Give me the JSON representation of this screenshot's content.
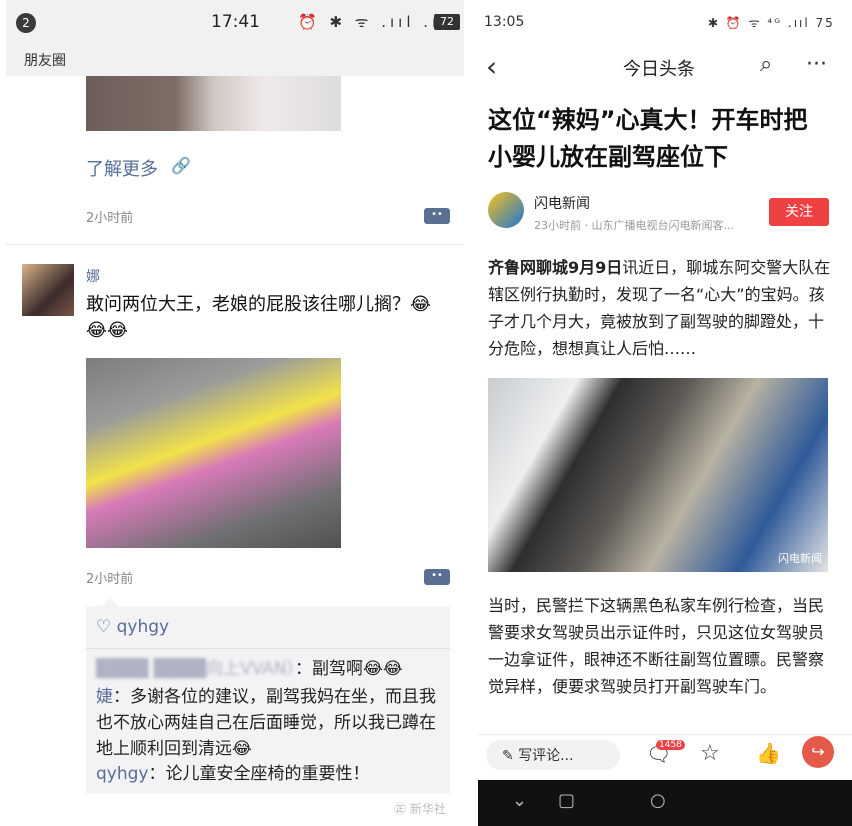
{
  "left": {
    "status": {
      "badge": "2",
      "time": "17:41",
      "icons": "⏰ ✱ ᯤ .ııl .ııl",
      "battery": "72"
    },
    "header_title": "朋友圈",
    "post1": {
      "learn_more": "了解更多",
      "time_ago": "2小时前"
    },
    "post2": {
      "username": "娜",
      "text": "敢问两位大王，老娘的屁股该往哪儿搁？😂😂😂",
      "time_ago": "2小时前",
      "likes": "♡ qyhgy",
      "comments": [
        {
          "name": "████ ████向上VVAN）",
          "text": "：副驾啊😂😂"
        },
        {
          "name": "婕",
          "text": "：多谢各位的建议，副驾我妈在坐，而且我也不放心两娃自己在后面睡觉，所以我已蹲在地上顺利回到清远😂"
        },
        {
          "name": "qyhgy",
          "text": "：论儿童安全座椅的重要性！"
        }
      ]
    },
    "watermark": "㊣ 新华社"
  },
  "right": {
    "status": {
      "time": "13:05",
      "icons": "✱ ⏰ ᯤ ⁴ᴳ .ııl 75"
    },
    "nav_title": "今日头条",
    "headline": "这位“辣妈”心真大！开车时把小婴儿放在副驾座位下",
    "source": {
      "name": "闪电新闻",
      "meta": "23小时前 · 山东广播电视台闪电新闻客...",
      "follow": "关注"
    },
    "lead_bold": "齐鲁网聊城9月9日",
    "lead_rest": "讯近日，聊城东阿交警大队在辖区例行执勤时，发现了一名“心大”的宝妈。孩子才几个月大，竟被放到了副驾驶的脚蹬处，十分危险，想想真让人后怕……",
    "photo_mark": "闪电新闻",
    "body2": "当时，民警拦下这辆黑色私家车例行检查，当民警要求女驾驶员出示证件时，只见这位女驾驶员一边拿证件，眼神还不断往副驾位置瞟。民警察觉异样，便要求驾驶员打开副驾驶车门。",
    "bottom": {
      "comment_label": "写评论...",
      "comment_count": "1458"
    }
  }
}
